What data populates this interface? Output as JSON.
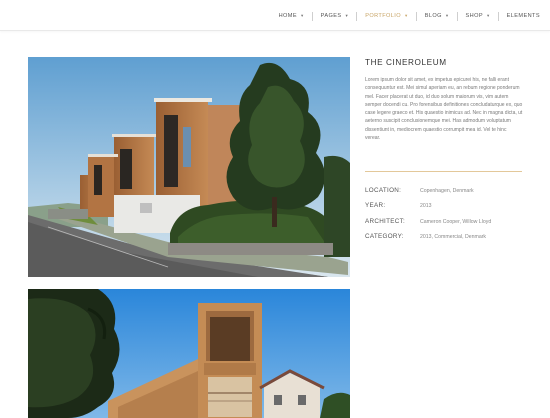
{
  "nav": {
    "items": [
      {
        "label": "HOME",
        "caret": "▾"
      },
      {
        "label": "PAGES",
        "caret": "▾"
      },
      {
        "label": "PORTFOLIO",
        "caret": "▾"
      },
      {
        "label": "BLOG",
        "caret": "▾"
      },
      {
        "label": "SHOP",
        "caret": "▾"
      },
      {
        "label": "ELEMENTS",
        "caret": ""
      }
    ],
    "active_index": 2
  },
  "project": {
    "title": "THE CINEROLEUM",
    "description": "Lorem ipsum dolor sit amet, ex impetus epicurei his, ne falli erant consequuntur est. Mei simul aperiam eu, an rebum regione ponderum mel. Facer placerat ut duo, id duo solum maiorum vis, vim autem semper docendi cu. Pro forensibus definitiones concludaturque ex, quo case legere graeco et. His quaestio inimicus ad. Nec in magna dicta, ut aeterno suscipit conclusionemque mei. Has admodum voluptatum dissentiunt in, mediocrem quaestio corrumpit mea id. Vel te hinc verear.",
    "details": [
      {
        "label": "LOCATION:",
        "value": "Copenhagen, Denmark"
      },
      {
        "label": "YEAR:",
        "value": "2013"
      },
      {
        "label": "ARCHITECT:",
        "value": "Cameron Cooper, Willow Lloyd"
      },
      {
        "label": "CATEGORY:",
        "value": "2013, Commercial, Denmark"
      }
    ]
  },
  "colors": {
    "accent": "#c8a465",
    "rule": "#e3c89a"
  }
}
